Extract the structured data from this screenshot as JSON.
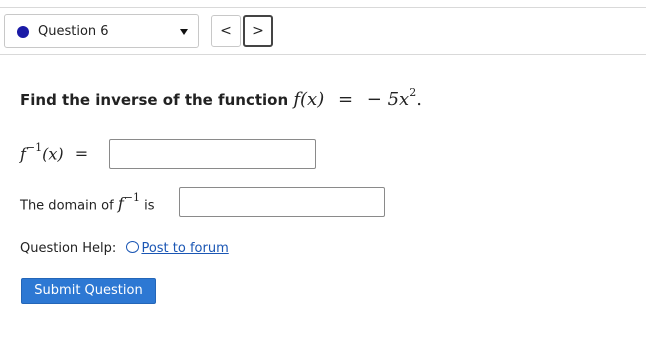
{
  "nav": {
    "question_label": "Question 6",
    "prev_label": "<",
    "next_label": ">"
  },
  "question": {
    "prompt_text": "Find the inverse of the function",
    "function_lhs": "f(x)",
    "equals": "=",
    "function_rhs": "− 5x",
    "rhs_exponent": "2",
    "period": ".",
    "inverse_symbol": "f",
    "inverse_exponent": "−1",
    "inverse_arg": "(x)",
    "domain_prefix": "The domain of",
    "domain_suffix": "is"
  },
  "inputs": {
    "inverse_value": "",
    "domain_value": ""
  },
  "help": {
    "label": "Question Help:",
    "forum_link": "Post to forum"
  },
  "submit_label": "Submit Question",
  "colors": {
    "accent": "#2d78d3",
    "link": "#1a56b4",
    "status_dot": "#1a1aa6"
  }
}
